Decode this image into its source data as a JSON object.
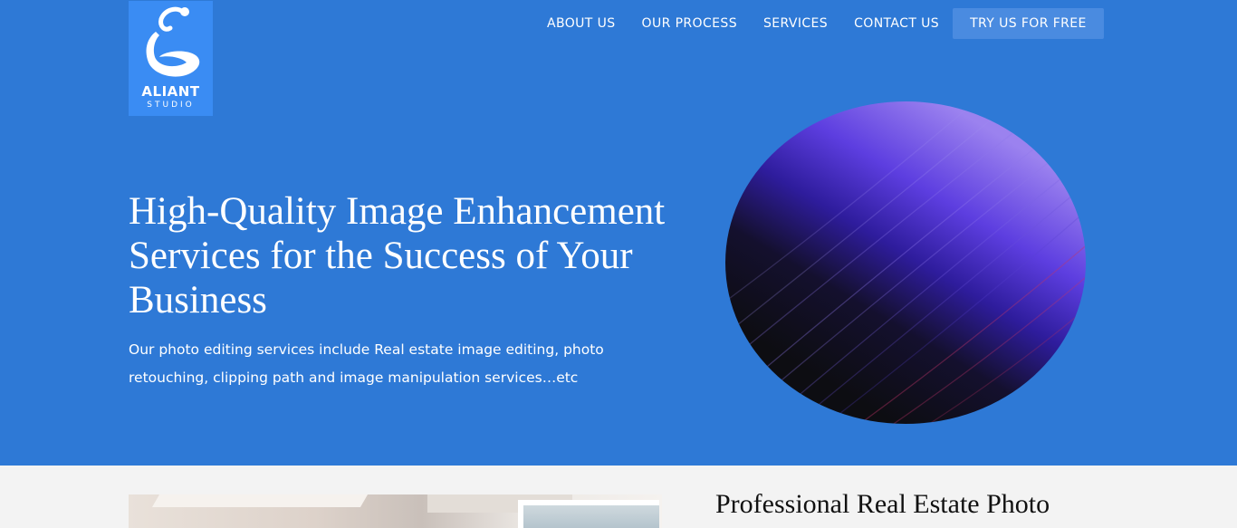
{
  "brand": {
    "name": "ALIANT",
    "tagline": "STUDIO",
    "logo_icon": "swirl-drop-icon"
  },
  "nav": {
    "items": [
      {
        "label": "ABOUT US"
      },
      {
        "label": "OUR PROCESS"
      },
      {
        "label": "SERVICES"
      },
      {
        "label": "CONTACT US"
      }
    ],
    "cta": "TRY US FOR FREE"
  },
  "hero": {
    "headline": "High-Quality Image Enhancement Services for the Success of Your Business",
    "subtext": "Our photo editing services include Real estate image editing, photo retouching, clipping path and image manipulation services…etc",
    "graphic": "gradient-sphere"
  },
  "section": {
    "title": "Professional Real Estate Photo"
  },
  "colors": {
    "hero_bg": "#2e79d6",
    "logo_bg": "#3a8cf3",
    "cta_bg": "#4a8be0",
    "section_bg": "#f3f3f3"
  }
}
